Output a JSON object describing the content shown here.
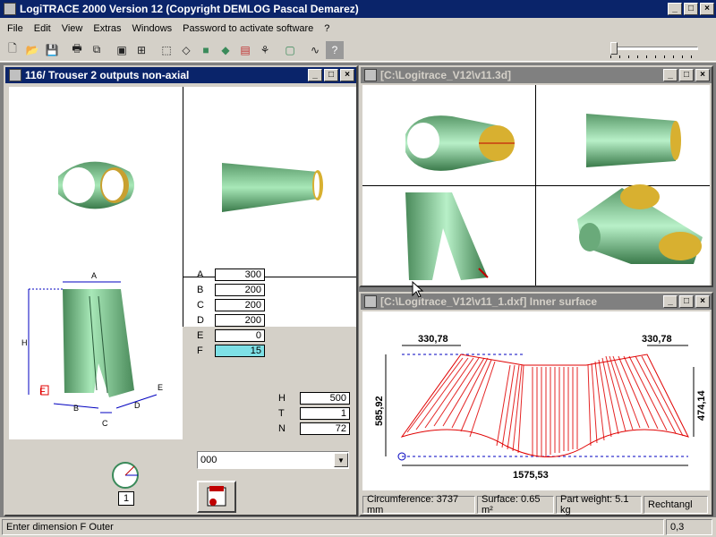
{
  "app": {
    "title": "LogiTRACE 2000  Version 12  (Copyright DEMLOG Pascal Demarez)"
  },
  "menu": [
    "File",
    "Edit",
    "View",
    "Extras",
    "Windows",
    "Password to activate software",
    "?"
  ],
  "win_left": {
    "title": "116/ Trouser 2 outputs non-axial"
  },
  "win_3d": {
    "title": "[C:\\Logitrace_V12\\v11.3d]"
  },
  "win_dxf": {
    "title": "[C:\\Logitrace_V12\\v11_1.dxf]  Inner surface"
  },
  "params": [
    {
      "label": "A",
      "value": "300"
    },
    {
      "label": "B",
      "value": "200"
    },
    {
      "label": "C",
      "value": "200"
    },
    {
      "label": "D",
      "value": "200"
    },
    {
      "label": "E",
      "value": "0"
    },
    {
      "label": "F",
      "value": "15"
    }
  ],
  "params2": [
    {
      "label": "H",
      "value": "500"
    },
    {
      "label": "T",
      "value": "1"
    },
    {
      "label": "N",
      "value": "72"
    }
  ],
  "select": {
    "value": "000"
  },
  "angle_field": {
    "value": "1"
  },
  "diagram_labels": {
    "A": "A",
    "H": "H",
    "F": "F",
    "B": "B",
    "C": "C",
    "D": "D",
    "E": "E"
  },
  "dxf_dims": {
    "top_left": "330,78",
    "top_right": "330,78",
    "left": "585,92",
    "right": "474,14",
    "bottom": "1575,53"
  },
  "info": {
    "circ": "Circumference: 3737 mm",
    "surface": "Surface: 0.65 m²",
    "weight": "Part weight: 5.1 kg",
    "mode": "Rechtangl"
  },
  "status": {
    "message": "Enter dimension F Outer",
    "coords": "0,3"
  },
  "colors": {
    "accent": "#0a246a",
    "solid": "#8fd9a8",
    "highlight": "#7ee0e6",
    "cut": "#e00000"
  }
}
